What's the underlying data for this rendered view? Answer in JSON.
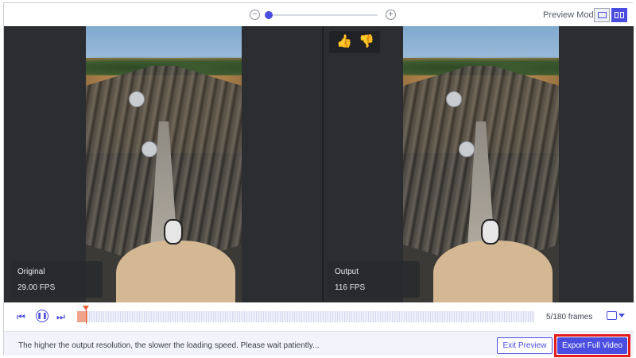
{
  "toolbar": {
    "zoom_out_icon": "minus-circle-icon",
    "zoom_in_icon": "plus-circle-icon",
    "zoom_level": 0.0,
    "preview_mode_label": "Preview Mode:",
    "preview_modes": [
      "single-view-icon",
      "split-view-icon"
    ],
    "active_mode": "split-view-icon"
  },
  "panes": {
    "original": {
      "name": "Original",
      "fps": "29.00 FPS"
    },
    "output": {
      "name": "Output",
      "fps": "116 FPS"
    }
  },
  "feedback": {
    "like_icon": "thumbs-up-icon",
    "dislike_icon": "thumbs-down-icon",
    "like_glyph": "👍",
    "dislike_glyph": "👎"
  },
  "timeline": {
    "prev_icon": "skip-previous-icon",
    "pause_icon": "pause-icon",
    "next_icon": "skip-next-icon",
    "prev_glyph": "⏮",
    "pause_glyph": "❚❚",
    "next_glyph": "⏭",
    "frame_counter": "5/180 frames",
    "current_frame": 5,
    "total_frames": 180,
    "snapshot_icon": "camera-icon"
  },
  "footer": {
    "hint": "The higher the output resolution, the slower the loading speed. Please wait patiently...",
    "exit_label": "Exit Preview",
    "export_label": "Export Full Video"
  },
  "colors": {
    "accent": "#4a4de0",
    "highlight": "#e31b1b",
    "playhead": "#e8603a"
  }
}
